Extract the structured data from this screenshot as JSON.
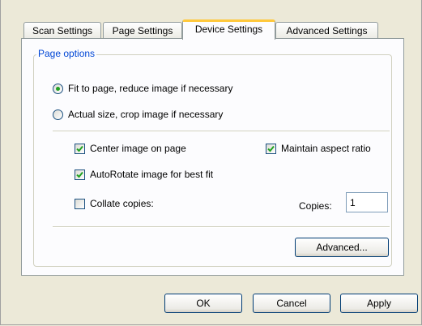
{
  "tabs": [
    {
      "label": "Scan Settings"
    },
    {
      "label": "Page Settings"
    },
    {
      "label": "Device Settings",
      "active": true
    },
    {
      "label": "Advanced Settings"
    }
  ],
  "page_options": {
    "title": "Page options",
    "radio_fit": {
      "label": "Fit to page, reduce image if necessary",
      "checked": true
    },
    "radio_actual": {
      "label": "Actual size, crop image if necessary",
      "checked": false
    },
    "center_image": {
      "label": "Center image on page",
      "checked": true
    },
    "maintain_aspect": {
      "label": "Maintain aspect ratio",
      "checked": true
    },
    "autorotate": {
      "label": "AutoRotate image for best fit",
      "checked": true
    },
    "collate": {
      "label": "Collate copies:",
      "checked": false
    },
    "copies_label": "Copies:",
    "copies_value": "1",
    "advanced_button": "Advanced..."
  },
  "footer": {
    "ok": "OK",
    "cancel": "Cancel",
    "apply": "Apply"
  },
  "colors": {
    "accent_tab": "#ffc83c",
    "group_label": "#0046d5",
    "check_green": "#21a121"
  }
}
